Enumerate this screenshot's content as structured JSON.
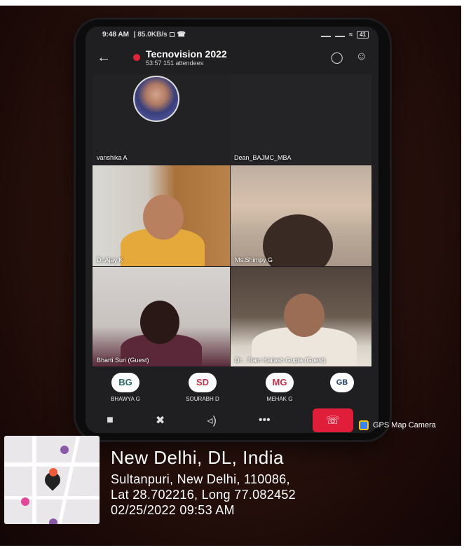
{
  "status_bar": {
    "time": "9:48 AM",
    "network": "85.0KB/s",
    "battery": "41"
  },
  "call_header": {
    "title": "Tecnovision 2022",
    "subtitle": "53:57  151 attendees",
    "back_icon": "back-arrow-icon",
    "chat_icon": "chat-icon",
    "participants_icon": "participants-icon"
  },
  "tiles": {
    "vanshika": "vanshika A",
    "dean": "Dean_BAJMC_MBA",
    "ajay": "Dr.Ajay K",
    "shimpy": "Ms.Shimpy G",
    "bharti": "Bharti Suri (Guest)",
    "ram": "Dr. . Ram Kailash Gupta (Guest)"
  },
  "chips": [
    {
      "initials": "BG",
      "name": "BHAWYA G",
      "color": "#2c6a6a"
    },
    {
      "initials": "SD",
      "name": "SOURABH D",
      "color": "#c0324a"
    },
    {
      "initials": "MG",
      "name": "MEHAK G",
      "color": "#c0324a"
    },
    {
      "initials": "GB",
      "name": "",
      "color": "#1f3a6b"
    }
  ],
  "controls": {
    "camera_icon": "camera-off-icon",
    "mic_icon": "mic-off-icon",
    "speaker_icon": "speaker-icon",
    "more_icon": "more-icon",
    "end_call_icon": "end-call-icon"
  },
  "gps": {
    "badge": "GPS Map Camera",
    "city": "New Delhi, DL, India",
    "address": "Sultanpuri, New Delhi, 110086,",
    "coords": "Lat 28.702216, Long 77.082452",
    "datetime": "02/25/2022 09:53 AM"
  }
}
